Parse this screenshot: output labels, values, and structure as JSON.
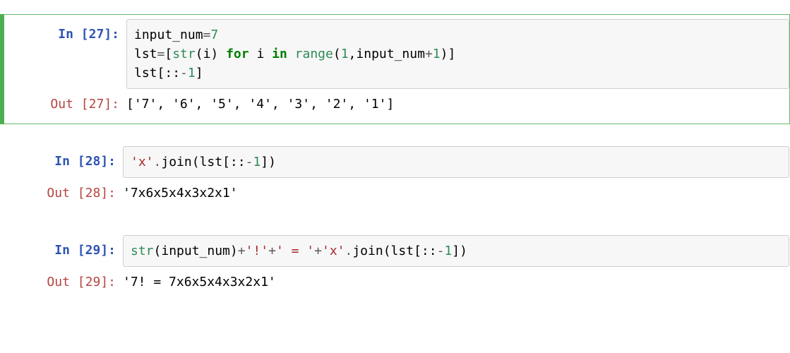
{
  "prompts": {
    "in_label": "In",
    "out_label": "Out"
  },
  "cells": [
    {
      "number": "27",
      "selected": true,
      "code_tokens": [
        [
          {
            "c": "tok-name",
            "t": "input_num"
          },
          {
            "c": "tok-op",
            "t": "="
          },
          {
            "c": "tok-num",
            "t": "7"
          }
        ],
        [
          {
            "c": "tok-name",
            "t": "lst"
          },
          {
            "c": "tok-op",
            "t": "="
          },
          {
            "c": "tok-punct",
            "t": "["
          },
          {
            "c": "tok-builtin",
            "t": "str"
          },
          {
            "c": "tok-punct",
            "t": "("
          },
          {
            "c": "tok-name",
            "t": "i"
          },
          {
            "c": "tok-punct",
            "t": ")"
          },
          {
            "c": "",
            "t": " "
          },
          {
            "c": "tok-kw",
            "t": "for"
          },
          {
            "c": "",
            "t": " "
          },
          {
            "c": "tok-name",
            "t": "i"
          },
          {
            "c": "",
            "t": " "
          },
          {
            "c": "tok-kw",
            "t": "in"
          },
          {
            "c": "",
            "t": " "
          },
          {
            "c": "tok-builtin",
            "t": "range"
          },
          {
            "c": "tok-punct",
            "t": "("
          },
          {
            "c": "tok-num",
            "t": "1"
          },
          {
            "c": "tok-punct",
            "t": ","
          },
          {
            "c": "tok-name",
            "t": "input_num"
          },
          {
            "c": "tok-op",
            "t": "+"
          },
          {
            "c": "tok-num",
            "t": "1"
          },
          {
            "c": "tok-punct",
            "t": ")"
          },
          {
            "c": "tok-punct",
            "t": "]"
          }
        ],
        [
          {
            "c": "tok-name",
            "t": "lst"
          },
          {
            "c": "tok-punct",
            "t": "["
          },
          {
            "c": "tok-punct",
            "t": ":"
          },
          {
            "c": "tok-punct",
            "t": ":"
          },
          {
            "c": "tok-op",
            "t": "-"
          },
          {
            "c": "tok-num",
            "t": "1"
          },
          {
            "c": "tok-punct",
            "t": "]"
          }
        ]
      ],
      "output": "['7', '6', '5', '4', '3', '2', '1']"
    },
    {
      "number": "28",
      "selected": false,
      "code_tokens": [
        [
          {
            "c": "tok-str",
            "t": "'x'"
          },
          {
            "c": "tok-op",
            "t": "."
          },
          {
            "c": "tok-name",
            "t": "join"
          },
          {
            "c": "tok-punct",
            "t": "("
          },
          {
            "c": "tok-name",
            "t": "lst"
          },
          {
            "c": "tok-punct",
            "t": "["
          },
          {
            "c": "tok-punct",
            "t": ":"
          },
          {
            "c": "tok-punct",
            "t": ":"
          },
          {
            "c": "tok-op",
            "t": "-"
          },
          {
            "c": "tok-num",
            "t": "1"
          },
          {
            "c": "tok-punct",
            "t": "]"
          },
          {
            "c": "tok-punct",
            "t": ")"
          }
        ]
      ],
      "output": "'7x6x5x4x3x2x1'"
    },
    {
      "number": "29",
      "selected": false,
      "code_tokens": [
        [
          {
            "c": "tok-builtin",
            "t": "str"
          },
          {
            "c": "tok-punct",
            "t": "("
          },
          {
            "c": "tok-name",
            "t": "input_num"
          },
          {
            "c": "tok-punct",
            "t": ")"
          },
          {
            "c": "tok-op",
            "t": "+"
          },
          {
            "c": "tok-str",
            "t": "'!'"
          },
          {
            "c": "tok-op",
            "t": "+"
          },
          {
            "c": "tok-str",
            "t": "' = '"
          },
          {
            "c": "tok-op",
            "t": "+"
          },
          {
            "c": "tok-str",
            "t": "'x'"
          },
          {
            "c": "tok-op",
            "t": "."
          },
          {
            "c": "tok-name",
            "t": "join"
          },
          {
            "c": "tok-punct",
            "t": "("
          },
          {
            "c": "tok-name",
            "t": "lst"
          },
          {
            "c": "tok-punct",
            "t": "["
          },
          {
            "c": "tok-punct",
            "t": ":"
          },
          {
            "c": "tok-punct",
            "t": ":"
          },
          {
            "c": "tok-op",
            "t": "-"
          },
          {
            "c": "tok-num",
            "t": "1"
          },
          {
            "c": "tok-punct",
            "t": "]"
          },
          {
            "c": "tok-punct",
            "t": ")"
          }
        ]
      ],
      "output": "'7! = 7x6x5x4x3x2x1'"
    }
  ]
}
